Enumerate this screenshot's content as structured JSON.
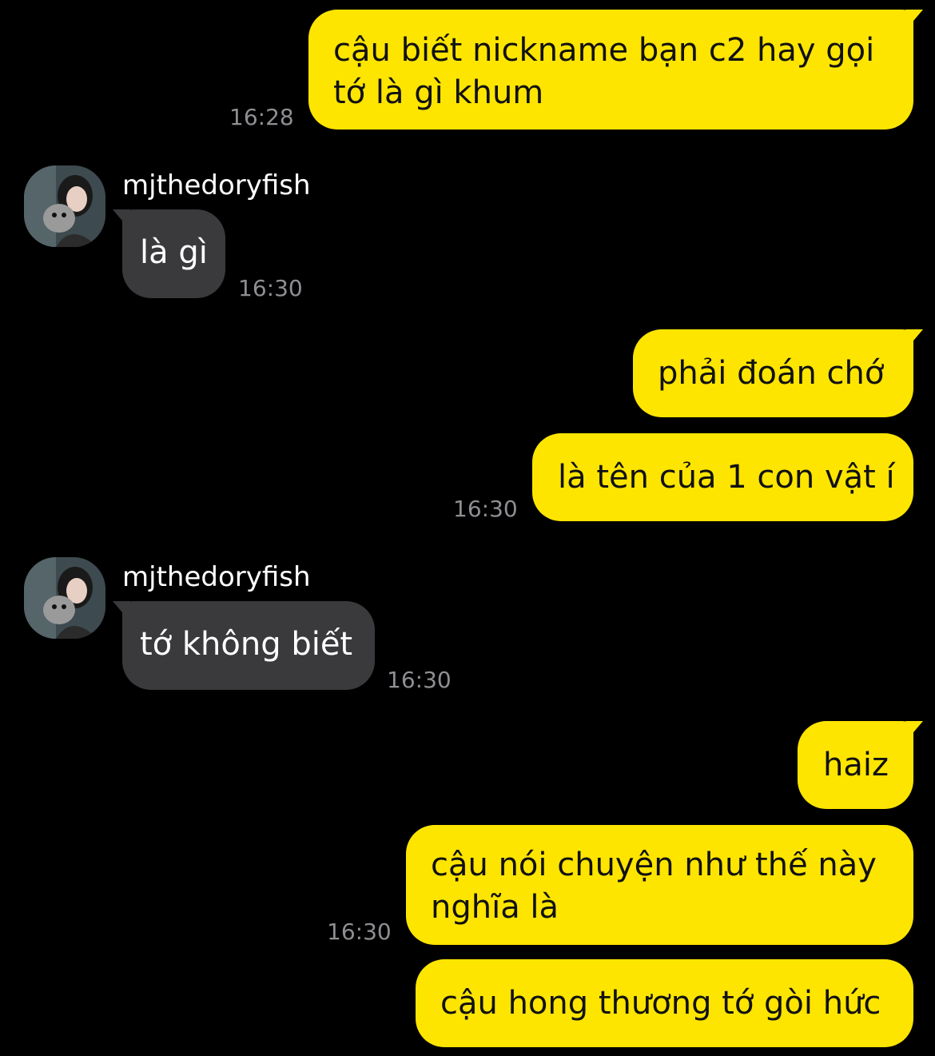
{
  "chat": {
    "contact_name": "mjthedoryfish",
    "messages": [
      {
        "from": "me",
        "text": "cậu biết nickname bạn c2 hay gọi\ntớ là gì khum",
        "time": "16:28"
      },
      {
        "from": "them",
        "sender": "mjthedoryfish",
        "text": "là gì",
        "time": "16:30"
      },
      {
        "from": "me",
        "text": "phải đoán chớ",
        "time": ""
      },
      {
        "from": "me",
        "text": "là tên của 1 con vật í",
        "time": "16:30"
      },
      {
        "from": "them",
        "sender": "mjthedoryfish",
        "text": "tớ không biết",
        "time": "16:30"
      },
      {
        "from": "me",
        "text": "haiz",
        "time": ""
      },
      {
        "from": "me",
        "text": "cậu nói chuyện như thế này\nnghĩa là",
        "time": "16:30"
      },
      {
        "from": "me",
        "text": "cậu hong thương tớ gòi hức",
        "time": ""
      }
    ]
  },
  "icons": {
    "avatar": "profile-photo-avatar"
  },
  "colors": {
    "background": "#000000",
    "my_bubble": "#FEE500",
    "their_bubble": "#3A3A3C",
    "timestamp": "#8E8E93"
  }
}
